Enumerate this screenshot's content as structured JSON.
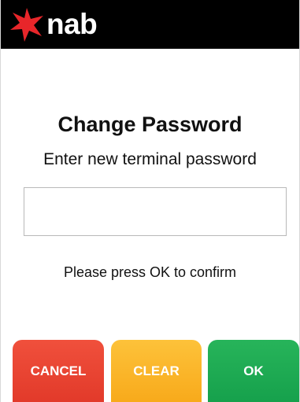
{
  "header": {
    "logo_text": "nab"
  },
  "main": {
    "title": "Change Password",
    "subtitle": "Enter new terminal password",
    "password_value": "",
    "hint": "Please press OK to confirm"
  },
  "buttons": {
    "cancel_label": "CANCEL",
    "clear_label": "CLEAR",
    "ok_label": "OK"
  },
  "colors": {
    "header_bg": "#000000",
    "logo_star": "#e8262a",
    "cancel": "#e8412f",
    "clear": "#fbb62a",
    "ok": "#1eab52"
  }
}
